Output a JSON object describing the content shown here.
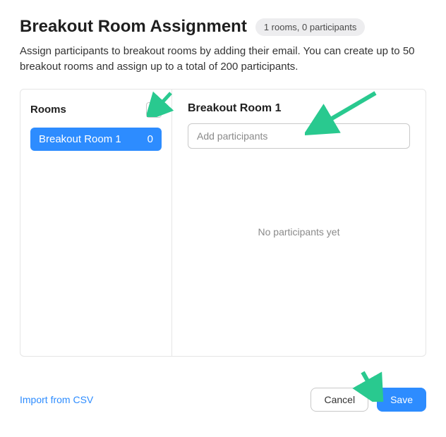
{
  "header": {
    "title": "Breakout Room Assignment",
    "badge": "1 rooms, 0 participants"
  },
  "intro": "Assign participants to breakout rooms by adding their email. You can create up to 50 breakout rooms and assign up to a total of 200 participants.",
  "sidebar": {
    "heading": "Rooms",
    "add_label": "+",
    "items": [
      {
        "name": "Breakout Room 1",
        "count": "0"
      }
    ]
  },
  "detail": {
    "title": "Breakout Room 1",
    "input_placeholder": "Add participants",
    "empty_text": "No participants yet"
  },
  "footer": {
    "import_label": "Import from CSV",
    "cancel_label": "Cancel",
    "save_label": "Save"
  },
  "colors": {
    "accent": "#2D8CFF",
    "arrow": "#29C98F"
  }
}
